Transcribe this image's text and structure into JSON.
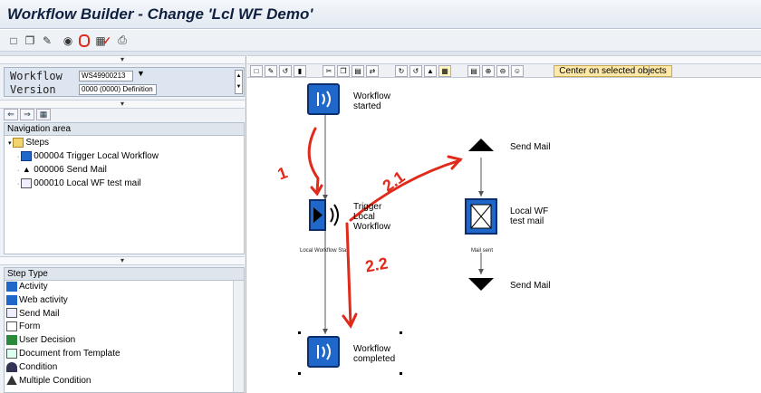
{
  "window": {
    "title": "Workflow Builder - Change 'Lcl WF Demo'"
  },
  "toolbar": {
    "icons": [
      "new-icon",
      "copy-icon",
      "edit-icon",
      "glasses-icon",
      "info-icon",
      "check-icon",
      "screen-icon",
      "print-icon"
    ]
  },
  "workflow_form": {
    "workflow_label": "Workflow",
    "workflow_value": "WS49900213",
    "version_label": "Version",
    "version_value": "0000 (0000) Definition"
  },
  "navigation": {
    "header": "Navigation area",
    "root": "Steps",
    "items": [
      {
        "id": "000004",
        "text": "Trigger Local Workflow"
      },
      {
        "id": "000006",
        "text": "Send Mail"
      },
      {
        "id": "000010",
        "text": "Local WF test mail"
      }
    ]
  },
  "step_types": {
    "header": "Step Type",
    "items": [
      "Activity",
      "Web activity",
      "Send Mail",
      "Form",
      "User Decision",
      "Document from Template",
      "Condition",
      "Multiple Condition"
    ]
  },
  "canvas": {
    "center_button": "Center on selected objects",
    "nodes": {
      "workflow_started": "Workflow\nstarted",
      "trigger": "Trigger\nLocal\nWorkflow",
      "trigger_sub": "Local Workflow Sta",
      "workflow_completed": "Workflow\ncompleted",
      "send_mail": "Send Mail",
      "local_wf": "Local WF\ntest mail",
      "mail_sent": "Mail sent",
      "send_mail_end": "Send Mail"
    },
    "annotations": {
      "a1": "1",
      "a21": "2.1",
      "a22": "2.2"
    }
  },
  "colors": {
    "accent": "#1f67c8",
    "annotation": "#e02a1a",
    "highlight": "#ffe9a8"
  }
}
